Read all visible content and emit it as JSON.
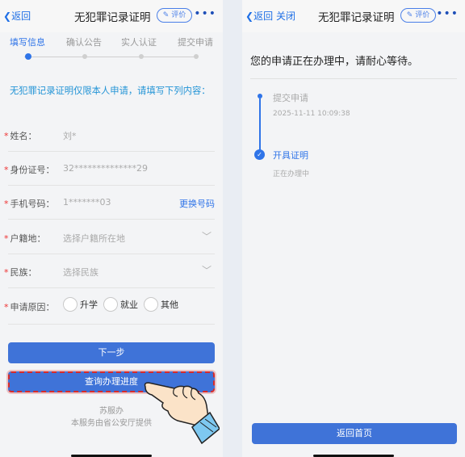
{
  "left": {
    "nav": {
      "back": "返回",
      "title": "无犯罪记录证明",
      "rate": "评价",
      "more": "•••"
    },
    "steps": [
      "填写信息",
      "确认公告",
      "实人认证",
      "提交申请"
    ],
    "note": "无犯罪记录证明仅限本人申请，请填写下列内容：",
    "fields": {
      "name": {
        "label": "姓名：",
        "value": "刘*"
      },
      "id": {
        "label": "身份证号：",
        "value": "32**************29"
      },
      "phone": {
        "label": "手机号码：",
        "value": "1*******03",
        "link": "更换号码"
      },
      "household": {
        "label": "户籍地：",
        "value": "选择户籍所在地"
      },
      "ethnicity": {
        "label": "民族：",
        "value": "选择民族"
      },
      "reason": {
        "label": "申请原因：",
        "options": [
          "升学",
          "就业",
          "其他"
        ]
      }
    },
    "buttons": {
      "next": "下一步",
      "progress": "查询办理进度"
    },
    "footer": {
      "org": "苏服办",
      "provider": "本服务由省公安厅提供"
    }
  },
  "right": {
    "nav": {
      "back": "返回",
      "close": "关闭",
      "title": "无犯罪记录证明",
      "rate": "评价",
      "more": "•••"
    },
    "status": "您的申请正在办理中，请耐心等待。",
    "timeline": [
      {
        "title": "提交申请",
        "sub": "2025-11-11 10:09:38"
      },
      {
        "title": "开具证明",
        "sub": "正在办理中"
      }
    ],
    "home_button": "返回首页"
  }
}
